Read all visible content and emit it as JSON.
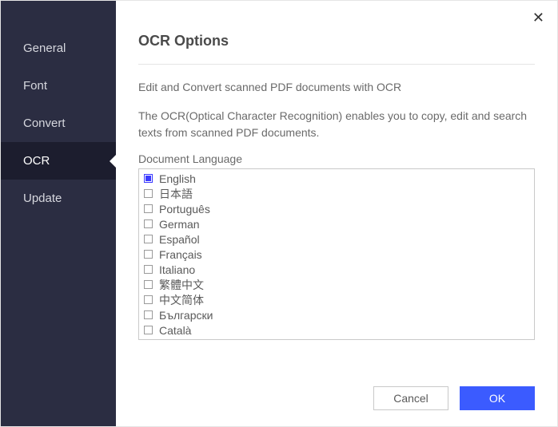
{
  "sidebar": {
    "items": [
      {
        "label": "General",
        "active": false
      },
      {
        "label": "Font",
        "active": false
      },
      {
        "label": "Convert",
        "active": false
      },
      {
        "label": "OCR",
        "active": true
      },
      {
        "label": "Update",
        "active": false
      }
    ]
  },
  "main": {
    "title": "OCR Options",
    "lead": "Edit and Convert scanned PDF documents with OCR",
    "desc": "The OCR(Optical Character Recognition) enables you to copy, edit and search texts from scanned PDF documents.",
    "lang_label": "Document Language",
    "languages": [
      {
        "label": "English",
        "checked": true
      },
      {
        "label": "日本語",
        "checked": false
      },
      {
        "label": "Português",
        "checked": false
      },
      {
        "label": "German",
        "checked": false
      },
      {
        "label": "Español",
        "checked": false
      },
      {
        "label": "Français",
        "checked": false
      },
      {
        "label": "Italiano",
        "checked": false
      },
      {
        "label": "繁體中文",
        "checked": false
      },
      {
        "label": "中文简体",
        "checked": false
      },
      {
        "label": "Български",
        "checked": false
      },
      {
        "label": "Català",
        "checked": false
      }
    ]
  },
  "footer": {
    "cancel": "Cancel",
    "ok": "OK"
  },
  "close_glyph": "✕"
}
